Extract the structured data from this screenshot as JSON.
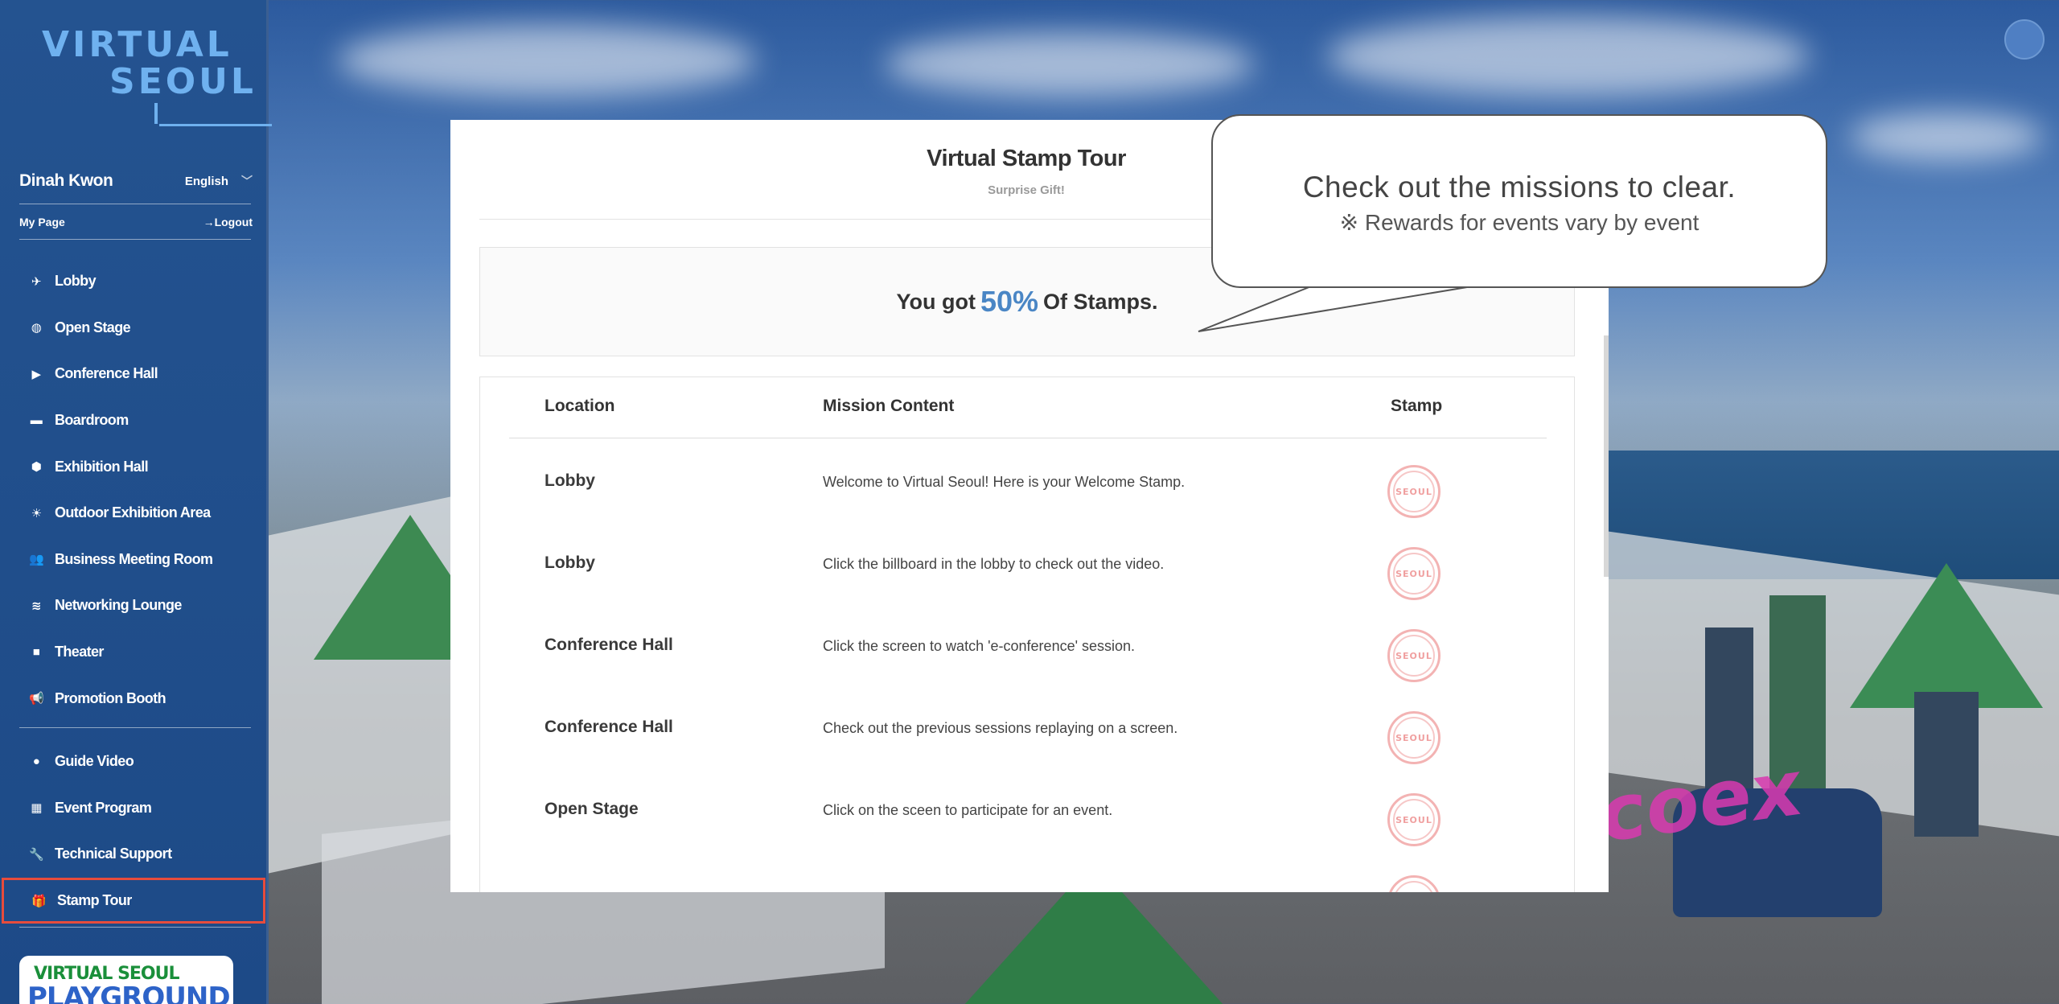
{
  "brand": {
    "logo_line1": "VIRTUAL",
    "logo_line2": "SEOUL",
    "playground_line1": "VIRTUAL SEOUL",
    "playground_line2": "PLAYGROUND"
  },
  "user": {
    "name": "Dinah Kwon",
    "language": "English",
    "my_page": "My Page",
    "logout": "→Logout"
  },
  "sidebar": {
    "items": [
      {
        "label": "Lobby",
        "icon": "plane-icon"
      },
      {
        "label": "Open Stage",
        "icon": "globe-icon"
      },
      {
        "label": "Conference Hall",
        "icon": "play-icon"
      },
      {
        "label": "Boardroom",
        "icon": "briefcase-icon"
      },
      {
        "label": "Exhibition Hall",
        "icon": "cube-icon"
      },
      {
        "label": "Outdoor Exhibition Area",
        "icon": "sun-icon"
      },
      {
        "label": "Business Meeting Room",
        "icon": "users-icon"
      },
      {
        "label": "Networking Lounge",
        "icon": "wifi-icon"
      },
      {
        "label": "Theater",
        "icon": "video-icon"
      },
      {
        "label": "Promotion Booth",
        "icon": "megaphone-icon"
      }
    ],
    "items2": [
      {
        "label": "Guide Video",
        "icon": "question-icon"
      },
      {
        "label": "Event Program",
        "icon": "calendar-icon"
      },
      {
        "label": "Technical Support",
        "icon": "wrench-icon"
      },
      {
        "label": "Stamp Tour",
        "icon": "gift-icon",
        "active": true
      }
    ]
  },
  "modal": {
    "title": "Virtual Stamp Tour",
    "subtitle": "Surprise Gift!",
    "progress_prefix": "You got",
    "progress_value": "50%",
    "progress_suffix": "Of Stamps.",
    "columns": [
      "Location",
      "Mission Content",
      "Stamp"
    ],
    "rows": [
      {
        "location": "Lobby",
        "mission": "Welcome to Virtual Seoul! Here is your Welcome Stamp.",
        "stamp": "SEOUL"
      },
      {
        "location": "Lobby",
        "mission": "Click the billboard in the lobby to check out the video.",
        "stamp": "SEOUL"
      },
      {
        "location": "Conference Hall",
        "mission": "Click the screen to watch 'e-conference' session.",
        "stamp": "SEOUL"
      },
      {
        "location": "Conference Hall",
        "mission": "Check out the previous sessions replaying on a screen.",
        "stamp": "SEOUL"
      },
      {
        "location": "Open Stage",
        "mission": "Click on the sceen to participate for an event.",
        "stamp": "SEOUL"
      }
    ]
  },
  "callout": {
    "line1": "Check out the missions to clear.",
    "line2": "※ Rewards for events vary by event"
  },
  "scene": {
    "sign_text": "coex"
  },
  "colors": {
    "sidebar_bg": "#245390",
    "accent": "#4a86c5",
    "active_outline": "#e74c3c"
  }
}
